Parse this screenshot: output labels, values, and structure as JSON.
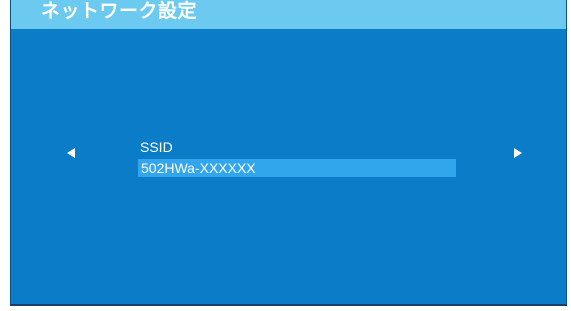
{
  "header": {
    "title": "ネットワーク設定"
  },
  "main": {
    "field_label": "SSID",
    "field_value": "502HWa-XXXXXX"
  },
  "navigation": {
    "prev_icon": "triangle-left-icon",
    "next_icon": "triangle-right-icon"
  },
  "colors": {
    "background": "#0a7cc8",
    "title_bar": "#6ccaf0",
    "field_highlight": "#31a6ec",
    "text": "#ffffff"
  }
}
